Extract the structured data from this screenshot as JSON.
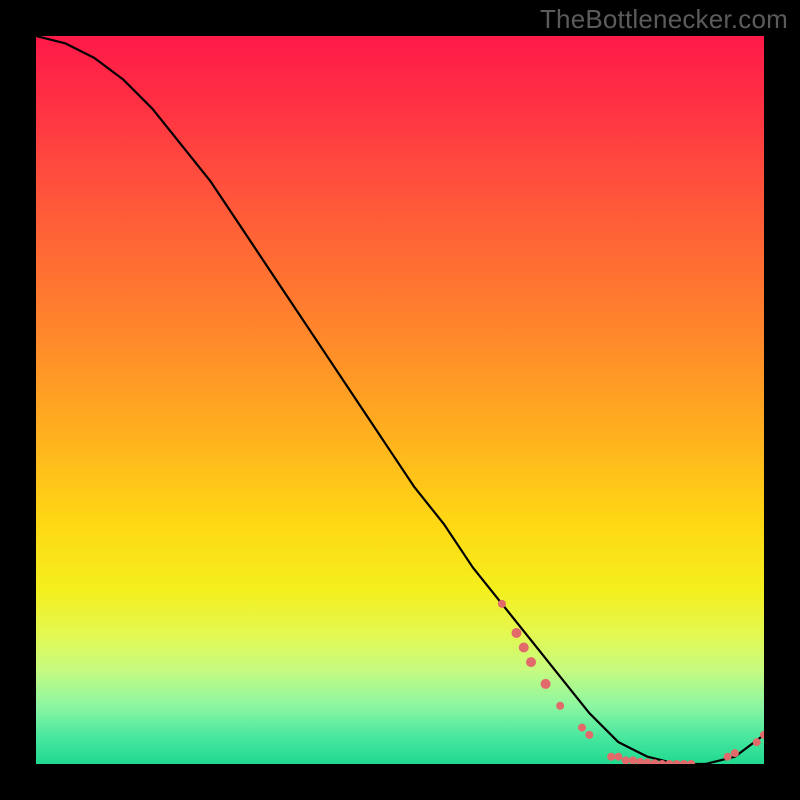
{
  "watermark": "TheBottlenecker.com",
  "gradient": {
    "top": "#ff1a48",
    "mid_high": "#ff8a2a",
    "mid": "#ffd814",
    "mid_low": "#e4f84f",
    "bottom": "#1fd98f"
  },
  "chart_data": {
    "type": "line",
    "title": "",
    "xlabel": "",
    "ylabel": "",
    "xlim": [
      0,
      100
    ],
    "ylim": [
      0,
      100
    ],
    "series": [
      {
        "name": "bottleneck-curve",
        "x": [
          0,
          4,
          8,
          12,
          16,
          20,
          24,
          28,
          32,
          36,
          40,
          44,
          48,
          52,
          56,
          60,
          64,
          68,
          72,
          76,
          80,
          84,
          88,
          92,
          96,
          100
        ],
        "y": [
          100,
          99,
          97,
          94,
          90,
          85,
          80,
          74,
          68,
          62,
          56,
          50,
          44,
          38,
          33,
          27,
          22,
          17,
          12,
          7,
          3,
          1,
          0,
          0,
          1,
          4
        ]
      }
    ],
    "markers": [
      {
        "name": "cluster-left-start",
        "x": 64,
        "y": 22,
        "r": 4,
        "color": "#e26a6a"
      },
      {
        "name": "cluster-left-2",
        "x": 66,
        "y": 18,
        "r": 5,
        "color": "#e26a6a"
      },
      {
        "name": "cluster-left-3",
        "x": 67,
        "y": 16,
        "r": 5,
        "color": "#e26a6a"
      },
      {
        "name": "cluster-left-4",
        "x": 68,
        "y": 14,
        "r": 5,
        "color": "#e26a6a"
      },
      {
        "name": "cluster-left-5",
        "x": 70,
        "y": 11,
        "r": 5,
        "color": "#e26a6a"
      },
      {
        "name": "cluster-left-6",
        "x": 72,
        "y": 8,
        "r": 4,
        "color": "#e26a6a"
      },
      {
        "name": "gap-dot-1",
        "x": 75,
        "y": 5,
        "r": 4,
        "color": "#e26a6a"
      },
      {
        "name": "gap-dot-2",
        "x": 76,
        "y": 4,
        "r": 4,
        "color": "#e26a6a"
      },
      {
        "name": "bottom-row-1",
        "x": 79,
        "y": 1,
        "r": 4,
        "color": "#e26a6a"
      },
      {
        "name": "bottom-row-2",
        "x": 80,
        "y": 1,
        "r": 4,
        "color": "#e26a6a"
      },
      {
        "name": "bottom-row-3",
        "x": 81,
        "y": 0.5,
        "r": 4,
        "color": "#e26a6a"
      },
      {
        "name": "bottom-row-4",
        "x": 82,
        "y": 0.5,
        "r": 4,
        "color": "#e26a6a"
      },
      {
        "name": "bottom-row-5",
        "x": 83,
        "y": 0.3,
        "r": 4,
        "color": "#e26a6a"
      },
      {
        "name": "bottom-row-6",
        "x": 84,
        "y": 0.2,
        "r": 4,
        "color": "#e26a6a"
      },
      {
        "name": "bottom-row-7",
        "x": 85,
        "y": 0.1,
        "r": 4,
        "color": "#e26a6a"
      },
      {
        "name": "bottom-row-8",
        "x": 86,
        "y": 0,
        "r": 4,
        "color": "#e26a6a"
      },
      {
        "name": "bottom-row-9",
        "x": 87,
        "y": 0,
        "r": 4,
        "color": "#e26a6a"
      },
      {
        "name": "bottom-row-10",
        "x": 88,
        "y": 0,
        "r": 4,
        "color": "#e26a6a"
      },
      {
        "name": "bottom-row-11",
        "x": 89,
        "y": 0,
        "r": 4,
        "color": "#e26a6a"
      },
      {
        "name": "bottom-row-12",
        "x": 90,
        "y": 0,
        "r": 4,
        "color": "#e26a6a"
      },
      {
        "name": "right-rise-1",
        "x": 95,
        "y": 1,
        "r": 4,
        "color": "#e26a6a"
      },
      {
        "name": "right-rise-2",
        "x": 96,
        "y": 1.5,
        "r": 4,
        "color": "#e26a6a"
      },
      {
        "name": "right-end-1",
        "x": 99,
        "y": 3,
        "r": 4,
        "color": "#e26a6a"
      },
      {
        "name": "right-end-2",
        "x": 100,
        "y": 4,
        "r": 4,
        "color": "#e26a6a"
      }
    ]
  }
}
